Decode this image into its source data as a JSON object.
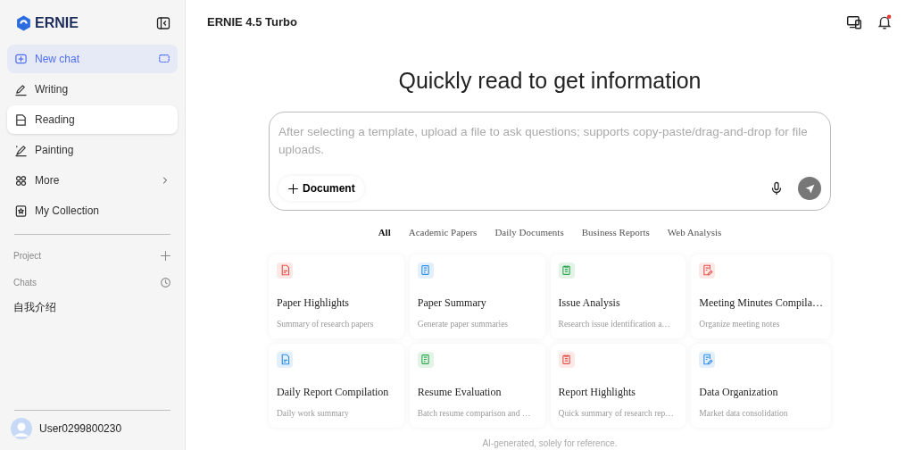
{
  "brand": {
    "name": "ERNIE"
  },
  "sidebar": {
    "items": [
      {
        "kind": "new",
        "label": "New chat",
        "selected": false
      },
      {
        "kind": "writing",
        "label": "Writing",
        "selected": false
      },
      {
        "kind": "reading",
        "label": "Reading",
        "selected": true
      },
      {
        "kind": "painting",
        "label": "Painting",
        "selected": false
      },
      {
        "kind": "more",
        "label": "More",
        "selected": false
      },
      {
        "kind": "collection",
        "label": "My Collection",
        "selected": false
      }
    ],
    "sections": [
      {
        "kind": "project",
        "label": "Project"
      },
      {
        "kind": "chats",
        "label": "Chats"
      }
    ],
    "chats": [
      "自我介绍"
    ],
    "user": {
      "name": "User0299800230"
    }
  },
  "header": {
    "model": "ERNIE 4.5 Turbo",
    "notification_unread": true
  },
  "main": {
    "heading": "Quickly read to get information",
    "input": {
      "placeholder": "After selecting a template, upload a file to ask questions; supports copy-paste/drag-and-drop for file uploads.",
      "attach_label": "Document"
    },
    "tabs": [
      {
        "label": "All",
        "selected": true
      },
      {
        "label": "Academic Papers",
        "selected": false
      },
      {
        "label": "Daily Documents",
        "selected": false
      },
      {
        "label": "Business Reports",
        "selected": false
      },
      {
        "label": "Web Analysis",
        "selected": false
      }
    ],
    "templates": [
      {
        "title": "Paper Highlights",
        "subtitle": "Summary of research papers",
        "color": "#e5534b"
      },
      {
        "title": "Paper Summary",
        "subtitle": "Generate paper summaries",
        "color": "#2f8ee5"
      },
      {
        "title": "Issue Analysis",
        "subtitle": "Research issue identification a…",
        "color": "#2fa84f"
      },
      {
        "title": "Meeting Minutes Compila…",
        "subtitle": "Organize meeting notes",
        "color": "#e5534b"
      },
      {
        "title": "Daily Report Compilation",
        "subtitle": "Daily work summary",
        "color": "#2f8ee5"
      },
      {
        "title": "Resume Evaluation",
        "subtitle": "Batch resume comparison and …",
        "color": "#2fa84f"
      },
      {
        "title": "Report Highlights",
        "subtitle": "Quick summary of research rep…",
        "color": "#e5534b"
      },
      {
        "title": "Data Organization",
        "subtitle": "Market data consolidation",
        "color": "#2f8ee5"
      }
    ],
    "footer": "AI-generated, solely for reference."
  }
}
